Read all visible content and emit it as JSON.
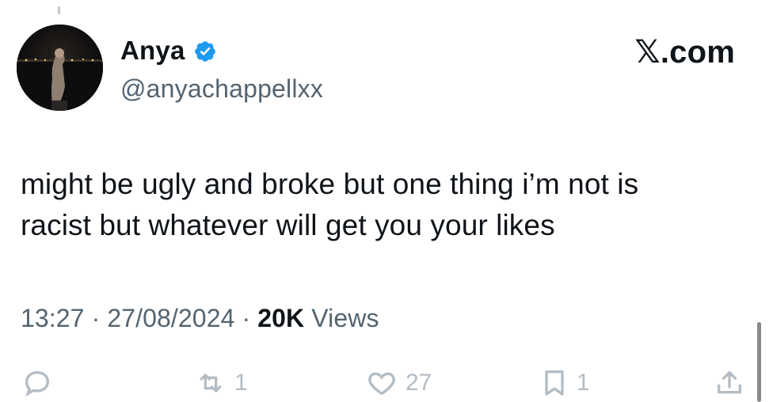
{
  "user": {
    "display_name": "Anya",
    "handle": "@anyachappellxx",
    "verified": true
  },
  "brand": "𝕏.com",
  "tweet": {
    "lines": [
      "might be ugly and broke but one thing i’m not is",
      "racist but whatever will get you your likes"
    ]
  },
  "meta": {
    "time": "13:27",
    "separator": "·",
    "date": "27/08/2024",
    "views_count": "20K",
    "views_label": "Views"
  },
  "actions": {
    "reply": {
      "icon": "reply-icon",
      "count": ""
    },
    "retweet": {
      "icon": "retweet-icon",
      "count": "1"
    },
    "like": {
      "icon": "heart-icon",
      "count": "27"
    },
    "bookmark": {
      "icon": "bookmark-icon",
      "count": "1"
    },
    "share": {
      "icon": "share-icon"
    }
  },
  "colors": {
    "text": "#0f1419",
    "secondary": "#536471",
    "action_faded": "#b4bcc3",
    "verified_blue": "#1d9bf0"
  }
}
